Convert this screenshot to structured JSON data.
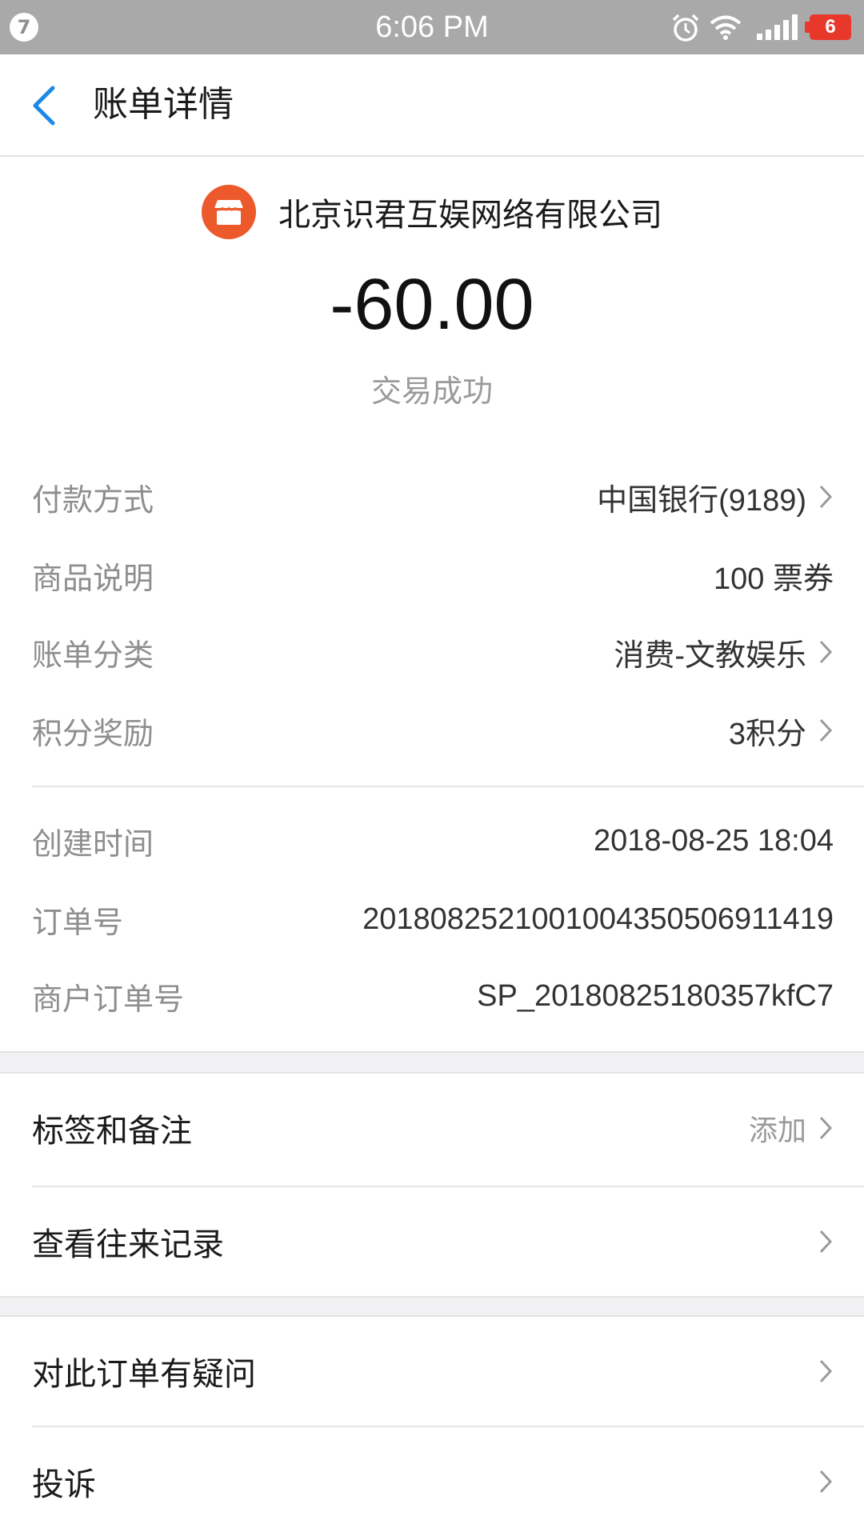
{
  "status_bar": {
    "badge": "7",
    "time": "6:06 PM",
    "battery": "6",
    "icons": [
      "alarm-icon",
      "wifi-icon",
      "signal-icon",
      "battery-icon"
    ]
  },
  "nav": {
    "back_icon": "chevron-left-icon",
    "title": "账单详情"
  },
  "merchant": {
    "logo_icon": "store-icon",
    "name": "北京识君互娱网络有限公司",
    "amount": "-60.00",
    "status": "交易成功"
  },
  "details": [
    {
      "label": "付款方式",
      "value": "中国银行(9189)",
      "has_arrow": true
    },
    {
      "label": "商品说明",
      "value": "100 票券",
      "has_arrow": false
    },
    {
      "label": "账单分类",
      "value": "消费-文教娱乐",
      "has_arrow": true
    },
    {
      "label": "积分奖励",
      "value": "3积分",
      "has_arrow": true
    }
  ],
  "order_info": [
    {
      "label": "创建时间",
      "value": "2018-08-25 18:04"
    },
    {
      "label": "订单号",
      "value": "2018082521001004350506911419"
    },
    {
      "label": "商户订单号",
      "value": "SP_20180825180357kfC7"
    }
  ],
  "actions_1": [
    {
      "label": "标签和备注",
      "right_text": "添加"
    },
    {
      "label": "查看往来记录",
      "right_text": ""
    }
  ],
  "actions_2": [
    {
      "label": "对此订单有疑问",
      "right_text": ""
    },
    {
      "label": "投诉",
      "right_text": ""
    }
  ],
  "colors": {
    "accent": "#1e88e5",
    "merchant_logo": "#ec5a2b",
    "status_bar": "#a9a9a9",
    "battery": "#e8382c"
  }
}
